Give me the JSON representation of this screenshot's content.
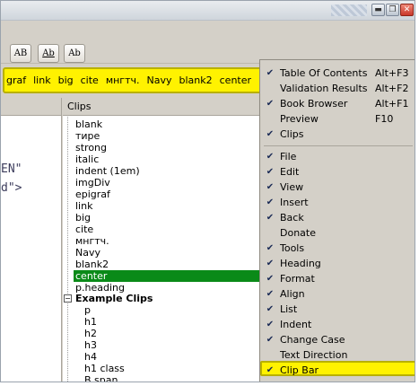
{
  "titlebar": {
    "minimize_icon": "minimize-icon",
    "maximize_icon": "maximize-icon",
    "close_icon": "close-icon",
    "minimize_glyph": "▬",
    "maximize_glyph": "❐",
    "close_glyph": "✕"
  },
  "toolbar": {
    "buttons": [
      "AB",
      "Ab",
      "Ab"
    ]
  },
  "clipbar": {
    "items": [
      "graf",
      "link",
      "big",
      "cite",
      "мнгтч.",
      "Navy",
      "blank2",
      "center"
    ],
    "highlight_color": "#fff200"
  },
  "editor": {
    "lines": [
      "EN\"",
      "d\">"
    ]
  },
  "clips_panel": {
    "title": "Clips",
    "items": [
      "blank",
      "тире",
      "strong",
      "italic",
      "indent (1em)",
      "imgDiv",
      "epigraf",
      "link",
      "big",
      "cite",
      "мнгтч.",
      "Navy",
      "blank2",
      "center",
      "p.heading"
    ],
    "selected": "center",
    "selected_color": "#0a8a18",
    "group_title": "Example Clips",
    "group_toggle": "−",
    "group_items": [
      "p",
      "h1",
      "h2",
      "h3",
      "h4",
      "h1 class",
      "B span"
    ]
  },
  "menu": {
    "check_glyph": "✔",
    "section1": [
      {
        "label": "Table Of Contents",
        "shortcut": "Alt+F3",
        "checked": true
      },
      {
        "label": "Validation Results",
        "shortcut": "Alt+F2",
        "checked": false
      },
      {
        "label": "Book Browser",
        "shortcut": "Alt+F1",
        "checked": true
      },
      {
        "label": "Preview",
        "shortcut": "F10",
        "checked": false
      },
      {
        "label": "Clips",
        "shortcut": "",
        "checked": true
      }
    ],
    "section2": [
      {
        "label": "File",
        "checked": true
      },
      {
        "label": "Edit",
        "checked": true
      },
      {
        "label": "View",
        "checked": true
      },
      {
        "label": "Insert",
        "checked": true
      },
      {
        "label": "Back",
        "checked": true
      },
      {
        "label": "Donate",
        "checked": false
      },
      {
        "label": "Tools",
        "checked": true
      },
      {
        "label": "Heading",
        "checked": true
      },
      {
        "label": "Format",
        "checked": true
      },
      {
        "label": "Align",
        "checked": true
      },
      {
        "label": "List",
        "checked": true
      },
      {
        "label": "Indent",
        "checked": true
      },
      {
        "label": "Change Case",
        "checked": true
      },
      {
        "label": "Text Direction",
        "checked": false
      },
      {
        "label": "Clip Bar",
        "checked": true
      }
    ],
    "highlighted": "Clip Bar"
  }
}
